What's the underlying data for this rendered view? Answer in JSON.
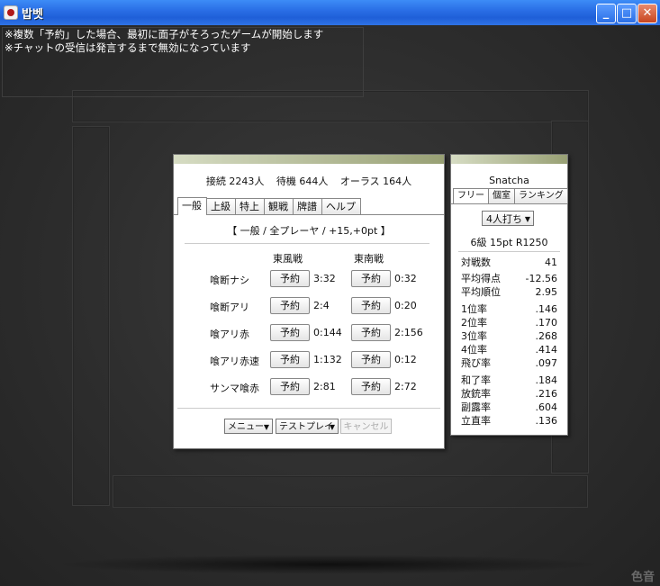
{
  "window": {
    "title": "밥벳",
    "controls": [
      "_",
      "□",
      "✕"
    ]
  },
  "chat": {
    "lines": [
      "※複数「予約」した場合、最初に面子がそろったゲームが開始します",
      "※チャットの受信は発言するまで無効になっています"
    ]
  },
  "lobby": {
    "stats": {
      "online": "接続 2243人",
      "waiting": "待機 644人",
      "allLast": "オーラス 164人"
    },
    "tabs": [
      "一般",
      "上級",
      "特上",
      "観戦",
      "牌譜",
      "ヘルプ"
    ],
    "activeTab": "一般",
    "heading": "【 一般 / 全プレーヤ / +15,+0pt 】",
    "columns": [
      "東風戦",
      "東南戦"
    ],
    "reserve_label": "予約",
    "rows": [
      {
        "label": "喰断ナシ",
        "east": "3:32",
        "south": "0:32"
      },
      {
        "label": "喰断アリ",
        "east": "2:4",
        "south": "0:20"
      },
      {
        "label": "喰アリ赤",
        "east": "0:144",
        "south": "2:156"
      },
      {
        "label": "喰アリ赤速",
        "east": "1:132",
        "south": "0:12"
      },
      {
        "label": "サンマ喰赤",
        "east": "2:81",
        "south": "2:72"
      }
    ],
    "footer": {
      "menu": "メニュー",
      "testplay": "テストプレイ",
      "cancel": "キャンセル"
    }
  },
  "profile": {
    "name": "Snatcha",
    "tabs": [
      "フリー",
      "個室",
      "ランキング"
    ],
    "mode": "4人打ち",
    "rank": "6級 15pt R1250",
    "stats": [
      {
        "label": "対戦数",
        "value": "41"
      },
      {
        "label": "平均得点",
        "value": "-12.56"
      },
      {
        "label": "平均順位",
        "value": "2.95"
      },
      {
        "label": "1位率",
        "value": ".146"
      },
      {
        "label": "2位率",
        "value": ".170"
      },
      {
        "label": "3位率",
        "value": ".268"
      },
      {
        "label": "4位率",
        "value": ".414"
      },
      {
        "label": "飛び率",
        "value": ".097"
      },
      {
        "label": "和了率",
        "value": ".184"
      },
      {
        "label": "放銃率",
        "value": ".216"
      },
      {
        "label": "副露率",
        "value": ".604"
      },
      {
        "label": "立直率",
        "value": ".136"
      }
    ]
  },
  "watermark": "色音"
}
